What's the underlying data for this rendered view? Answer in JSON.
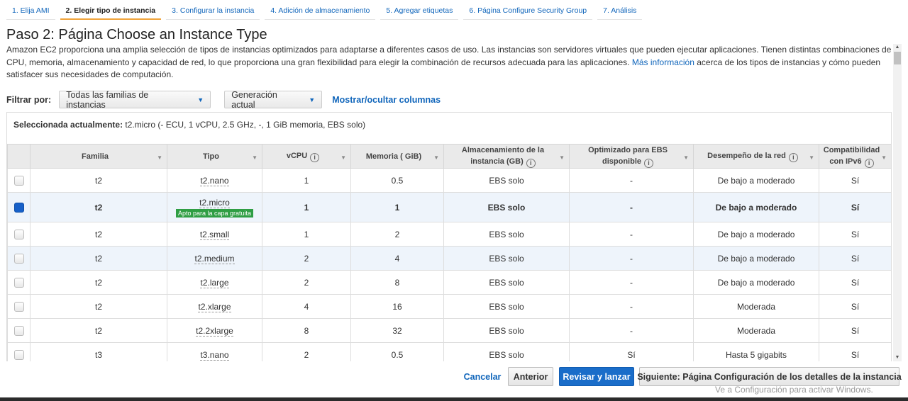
{
  "tabs": [
    {
      "label": "1. Elija AMI",
      "active": false
    },
    {
      "label": "2. Elegir tipo de instancia",
      "active": true
    },
    {
      "label": "3. Configurar la instancia",
      "active": false
    },
    {
      "label": "4. Adición de almacenamiento",
      "active": false
    },
    {
      "label": "5. Agregar etiquetas",
      "active": false
    },
    {
      "label": "6. Página Configure Security Group",
      "active": false
    },
    {
      "label": "7. Análisis",
      "active": false
    }
  ],
  "page_title": "Paso 2: Página Choose an Instance Type",
  "intro": {
    "text_before": "Amazon EC2 proporciona una amplia selección de tipos de instancias optimizados para adaptarse a diferentes casos de uso. Las instancias son servidores virtuales que pueden ejecutar aplicaciones. Tienen distintas combinaciones de CPU, memoria, almacenamiento y capacidad de red, lo que proporciona una gran flexibilidad para elegir la combinación de recursos adecuada para las aplicaciones.",
    "link": "Más información",
    "text_after": "acerca de los tipos de instancias y cómo pueden satisfacer sus necesidades de computación."
  },
  "filter": {
    "label": "Filtrar por:",
    "family_value": "Todas las familias de instancias",
    "generation_value": "Generación actual",
    "toggle_columns": "Mostrar/ocultar columnas"
  },
  "selected": {
    "label": "Seleccionada actualmente:",
    "value": "t2.micro (- ECU, 1 vCPU, 2.5 GHz, -, 1  GiB memoria, EBS solo)"
  },
  "table": {
    "headers": {
      "family": "Familia",
      "type": "Tipo",
      "vcpu": "vCPU",
      "memory": "Memoria ( GiB)",
      "storage_1": "Almacenamiento de la",
      "storage_2": "instancia (GB)",
      "ebs_1": "Optimizado para EBS",
      "ebs_2": "disponible",
      "network": "Desempeño de la red",
      "ipv6_1": "Compatibilidad",
      "ipv6_2": "con IPv6"
    },
    "free_tier_label": "Apto para la capa gratuita",
    "rows": [
      {
        "family": "t2",
        "type": "t2.nano",
        "vcpu": "1",
        "memory": "0.5",
        "storage": "EBS solo",
        "ebs": "-",
        "network": "De bajo a moderado",
        "ipv6": "Sí"
      },
      {
        "family": "t2",
        "type": "t2.micro",
        "vcpu": "1",
        "memory": "1",
        "storage": "EBS solo",
        "ebs": "-",
        "network": "De bajo a moderado",
        "ipv6": "Sí"
      },
      {
        "family": "t2",
        "type": "t2.small",
        "vcpu": "1",
        "memory": "2",
        "storage": "EBS solo",
        "ebs": "-",
        "network": "De bajo a moderado",
        "ipv6": "Sí"
      },
      {
        "family": "t2",
        "type": "t2.medium",
        "vcpu": "2",
        "memory": "4",
        "storage": "EBS solo",
        "ebs": "-",
        "network": "De bajo a moderado",
        "ipv6": "Sí"
      },
      {
        "family": "t2",
        "type": "t2.large",
        "vcpu": "2",
        "memory": "8",
        "storage": "EBS solo",
        "ebs": "-",
        "network": "De bajo a moderado",
        "ipv6": "Sí"
      },
      {
        "family": "t2",
        "type": "t2.xlarge",
        "vcpu": "4",
        "memory": "16",
        "storage": "EBS solo",
        "ebs": "-",
        "network": "Moderada",
        "ipv6": "Sí"
      },
      {
        "family": "t2",
        "type": "t2.2xlarge",
        "vcpu": "8",
        "memory": "32",
        "storage": "EBS solo",
        "ebs": "-",
        "network": "Moderada",
        "ipv6": "Sí"
      },
      {
        "family": "t3",
        "type": "t3.nano",
        "vcpu": "2",
        "memory": "0.5",
        "storage": "EBS solo",
        "ebs": "Sí",
        "network": "Hasta 5 gigabits",
        "ipv6": "Sí"
      }
    ]
  },
  "footer": {
    "cancel": "Cancelar",
    "previous": "Anterior",
    "review_launch": "Revisar y lanzar",
    "next": "Siguiente: Página Configuración de los detalles de la instancia"
  },
  "watermark": "Ve a Configuración para activar Windows."
}
